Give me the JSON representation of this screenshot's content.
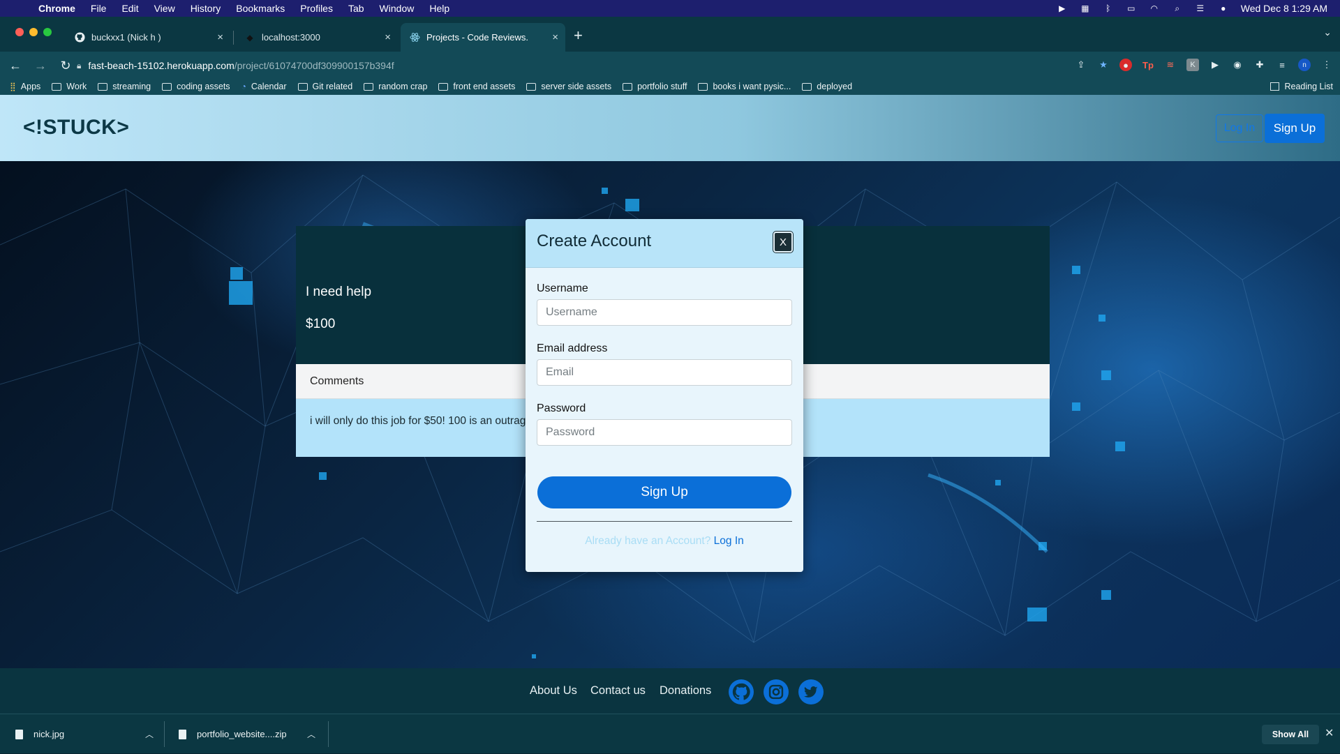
{
  "menubar": {
    "app": "Chrome",
    "items": [
      "File",
      "Edit",
      "View",
      "History",
      "Bookmarks",
      "Profiles",
      "Tab",
      "Window",
      "Help"
    ],
    "clock": "Wed Dec 8  1:29 AM"
  },
  "tabs": [
    {
      "title": "buckxx1 (Nick h )",
      "icon": "github-icon"
    },
    {
      "title": "localhost:3000",
      "icon": "react-icon"
    },
    {
      "title": "Projects - Code Reviews.",
      "icon": "react-icon"
    }
  ],
  "address": {
    "host": "fast-beach-15102.herokuapp.com",
    "path": "/project/61074700df309900157b394f"
  },
  "bookmarks": {
    "items": [
      "Apps",
      "Work",
      "streaming",
      "coding assets",
      "Calendar",
      "Git related",
      "random crap",
      "front end assets",
      "server side assets",
      "portfolio stuff",
      "books i want pysic...",
      "deployed"
    ],
    "reading_list": "Reading List"
  },
  "site": {
    "logo": "<!STUCK>",
    "login_label": "Log In",
    "signup_label": "Sign Up"
  },
  "project": {
    "title": "I need help",
    "price": "$100",
    "comments_header": "Comments",
    "comment": "i will only do this job for $50! 100 is an outrageous price"
  },
  "modal": {
    "title": "Create Account",
    "close_label": "X",
    "username_label": "Username",
    "username_placeholder": "Username",
    "email_label": "Email address",
    "email_placeholder": "Email",
    "password_label": "Password",
    "password_placeholder": "Password",
    "submit_label": "Sign Up",
    "footer_question": "Already have an Account?",
    "footer_link": "Log In"
  },
  "footer": {
    "links": [
      "About Us",
      "Contact us",
      "Donations"
    ],
    "social": [
      "github-icon",
      "instagram-icon",
      "twitter-icon"
    ]
  },
  "downloads": {
    "files": [
      "nick.jpg",
      "portfolio_website....zip"
    ],
    "show_all": "Show All"
  },
  "colors": {
    "accent": "#0b6fd8",
    "header_light": "#bfe6f8",
    "modal_head": "#b8e4f9",
    "card_dark": "#08303c",
    "comment_bg": "#b3e3fa"
  }
}
